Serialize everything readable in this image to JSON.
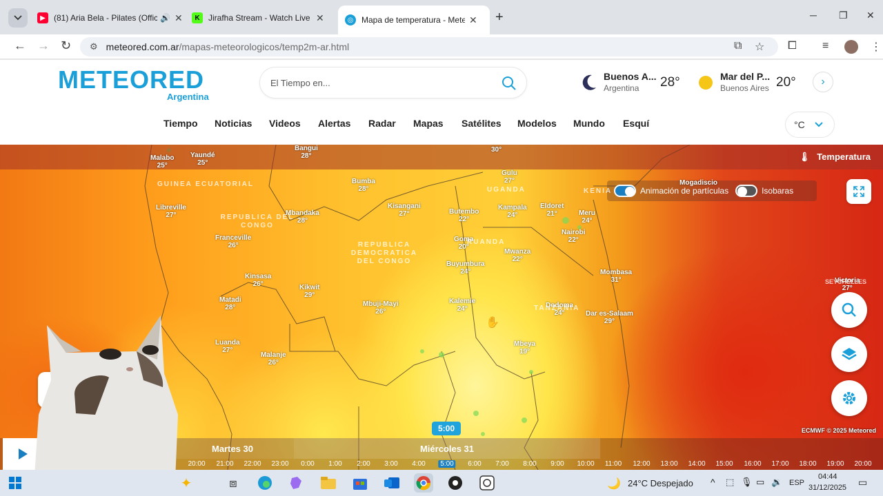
{
  "browser": {
    "tabs": [
      {
        "title": "(81) Aria Bela - Pilates (Offic",
        "favicon_color": "#ff0033",
        "muted_icon": "speaker-icon"
      },
      {
        "title": "Jirafha Stream - Watch Live on",
        "favicon_color": "#53fc18"
      },
      {
        "title": "Mapa de temperatura - Meteor",
        "favicon_color": "#1a9fd8"
      }
    ],
    "url_host": "meteored.com.ar",
    "url_path": "/mapas-meteorologicos/temp2m-ar.html"
  },
  "site": {
    "logo": "METEORED",
    "logo_sub": "Argentina",
    "search_placeholder": "El Tiempo en...",
    "cities": [
      {
        "name": "Buenos A...",
        "region": "Argentina",
        "temp": "28°"
      },
      {
        "name": "Mar del P...",
        "region": "Buenos Aires",
        "temp": "20°"
      }
    ],
    "nav": [
      "Tiempo",
      "Noticias",
      "Videos",
      "Alertas",
      "Radar",
      "Mapas",
      "Satélites",
      "Modelos",
      "Mundo",
      "Esquí"
    ],
    "unit": "°C"
  },
  "map": {
    "layer_title": "Temperatura",
    "toggle_particles": "Animación de partículas",
    "toggle_isobars": "Isobaras",
    "copyright": "ECMWF © 2025 Meteored",
    "current_time": "5:00",
    "days": [
      "Martes 30",
      "Miércoles 31"
    ],
    "hours": [
      "20:00",
      "21:00",
      "22:00",
      "23:00",
      "0:00",
      "1:00",
      "2:00",
      "3:00",
      "4:00",
      "5:00",
      "6:00",
      "7:00",
      "8:00",
      "9:00",
      "10:00",
      "11:00",
      "12:00",
      "13:00",
      "14:00",
      "15:00",
      "16:00",
      "17:00",
      "18:00",
      "19:00",
      "20:00"
    ],
    "cities": [
      {
        "name": "Malabo",
        "temp": "25°"
      },
      {
        "name": "Yaundé",
        "temp": "25°"
      },
      {
        "name": "Bangui",
        "temp": "28°"
      },
      {
        "name": "",
        "temp": "30°"
      },
      {
        "name": "Gulu",
        "temp": "27°"
      },
      {
        "name": "Bumba",
        "temp": "28°"
      },
      {
        "name": "Libreville",
        "temp": "27°"
      },
      {
        "name": "Kisangani",
        "temp": "27°"
      },
      {
        "name": "Butembo",
        "temp": "22°"
      },
      {
        "name": "Kampala",
        "temp": "24°"
      },
      {
        "name": "Eldoret",
        "temp": "21°"
      },
      {
        "name": "Meru",
        "temp": "24°"
      },
      {
        "name": "Mbandaka",
        "temp": "28°"
      },
      {
        "name": "Nairobi",
        "temp": "22°"
      },
      {
        "name": "Franceville",
        "temp": "26°"
      },
      {
        "name": "Goma",
        "temp": "20°"
      },
      {
        "name": "Mwanza",
        "temp": "22°"
      },
      {
        "name": "Buyumbura",
        "temp": "24°"
      },
      {
        "name": "Mombasa",
        "temp": "31°"
      },
      {
        "name": "Kinsasa",
        "temp": "26°"
      },
      {
        "name": "Kikwit",
        "temp": "29°"
      },
      {
        "name": "Matadi",
        "temp": "28°"
      },
      {
        "name": "Mbuji-Mayi",
        "temp": "26°"
      },
      {
        "name": "Kalemie",
        "temp": "24°"
      },
      {
        "name": "Dodoma",
        "temp": "24°"
      },
      {
        "name": "Dar es-Salaam",
        "temp": "29°"
      },
      {
        "name": "Mogadiscio",
        "temp": ""
      },
      {
        "name": "Victoria",
        "temp": "27°"
      },
      {
        "name": "Luanda",
        "temp": "27°"
      },
      {
        "name": "Malanje",
        "temp": "26°"
      },
      {
        "name": "Mbeya",
        "temp": "19°"
      }
    ],
    "regions": [
      "GUINEA ECUATORIAL",
      "REPUBLICA DEL CONGO",
      "REPUBLICA DEMOCRATICA DEL CONGO",
      "UGANDA",
      "KENIA",
      "RUANDA",
      "TANZANIA",
      "SEYCHELLES"
    ]
  },
  "taskbar": {
    "weather": "24°C  Despejado",
    "lang": "ESP",
    "time": "04:44",
    "date": "31/12/2025"
  }
}
